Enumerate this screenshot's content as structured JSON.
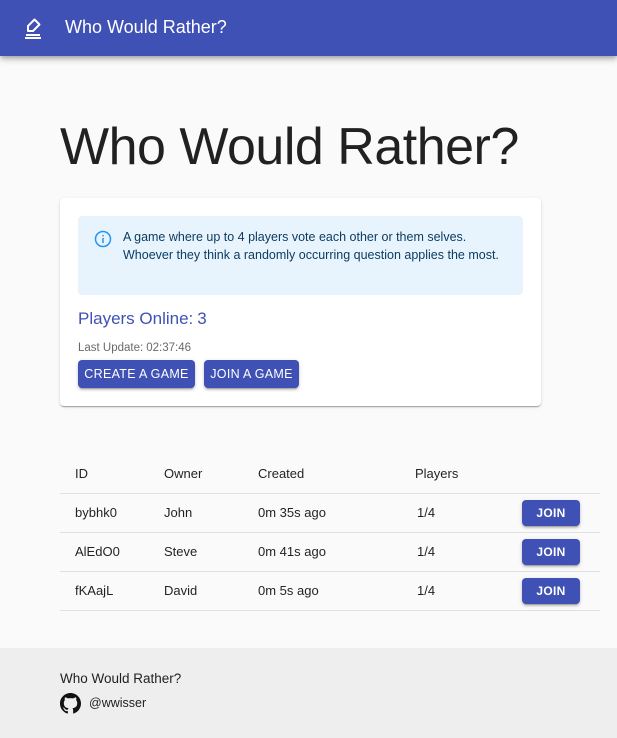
{
  "appbar": {
    "title": "Who Would Rather?",
    "icon": "poll-edit-icon",
    "color": "#3f51b5"
  },
  "hero": {
    "title": "Who Would Rather?"
  },
  "info_card": {
    "alert_icon": "info-icon",
    "alert_text": "A game where up to 4 players vote each other or them selves. Whoever they think a randomly occurring question applies the most.",
    "players_online_label": "Players Online:",
    "players_online_count": "3",
    "last_update_label": "Last Update:",
    "last_update_time": "02:37:46",
    "create_button": "Create a game",
    "join_button": "Join a game"
  },
  "games_table": {
    "headers": {
      "id": "ID",
      "owner": "Owner",
      "created": "Created",
      "players": "Players"
    },
    "rows": [
      {
        "id": "bybhk0",
        "owner": "John",
        "created": "0m 35s ago",
        "players": "1/4",
        "action": "JOIN"
      },
      {
        "id": "AlEdO0",
        "owner": "Steve",
        "created": "0m 41s ago",
        "players": "1/4",
        "action": "JOIN"
      },
      {
        "id": "fKAajL",
        "owner": "David",
        "created": "0m 5s ago",
        "players": "1/4",
        "action": "JOIN"
      }
    ]
  },
  "footer": {
    "title": "Who Would Rather?",
    "icon": "github-icon",
    "handle": "@wwisser"
  }
}
